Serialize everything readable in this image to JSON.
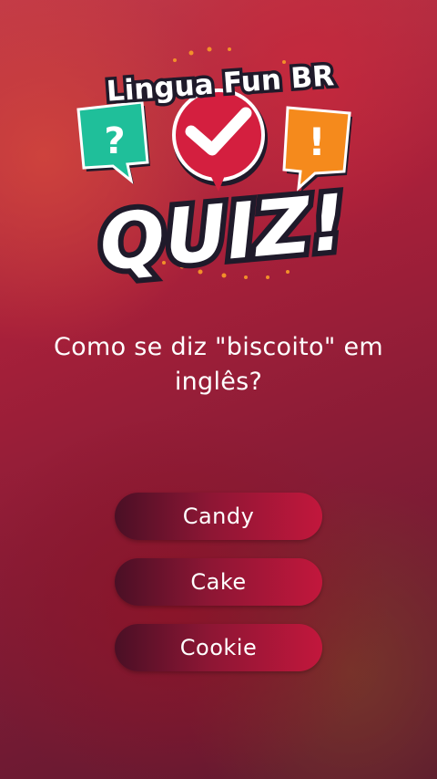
{
  "logo": {
    "brand": "Lingua Fun BR",
    "title": "QUIZ!",
    "bubble_left_symbol": "?",
    "bubble_right_symbol": "!",
    "bubble_left_color": "#1fbf9a",
    "bubble_center_color": "#d41f3f",
    "bubble_right_color": "#f58a1c",
    "center_icon": "checkmark-icon"
  },
  "question": {
    "line1": "Como se diz \"biscoito\" em",
    "line2": "inglês?"
  },
  "answers": [
    {
      "label": "Candy"
    },
    {
      "label": "Cake"
    },
    {
      "label": "Cookie"
    }
  ],
  "colors": {
    "button_dark": "#4a0f25",
    "button_bright": "#c2173c",
    "text": "#ffffff"
  }
}
